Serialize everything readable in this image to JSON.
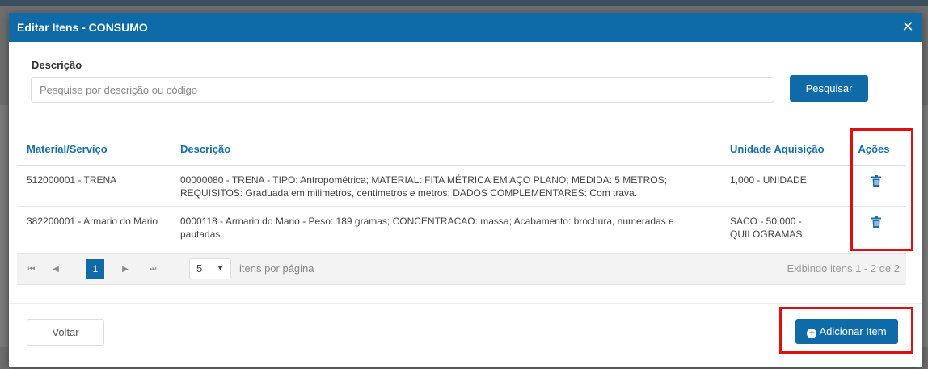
{
  "modal": {
    "title": "Editar Itens - CONSUMO",
    "close_glyph": "✕"
  },
  "search": {
    "label": "Descrição",
    "placeholder": "Pesquise por descrição ou código",
    "value": "",
    "button_label": "Pesquisar"
  },
  "table": {
    "headers": [
      "Material/Serviço",
      "Descrição",
      "Unidade Aquisição",
      "Ações"
    ],
    "rows": [
      {
        "material": "512000001 - TRENA",
        "descricao": "00000080 - TRENA - TIPO: Antropométrica; MATERIAL: FITA MÉTRICA EM AÇO PLANO; MEDIDA: 5 METROS; REQUISITOS: Graduada em milimetros, centimetros e metros; DADOS COMPLEMENTARES: Com trava.",
        "unidade": "1,000 - UNIDADE",
        "action_icon": "trash-icon"
      },
      {
        "material": "382200001 - Armario do Mario",
        "descricao": "0000118 - Armario do Mario - Peso: 189 gramas; CONCENTRACAO: massa; Acabamento: brochura, numeradas e pautadas.",
        "unidade": "SACO - 50,000 - QUILOGRAMAS",
        "action_icon": "trash-icon"
      }
    ]
  },
  "pager": {
    "first": "⏮",
    "prev": "◀",
    "next": "▶",
    "last": "⏭",
    "current_page": "1",
    "page_size": "5",
    "per_page_label": "itens por página",
    "showing_label": "Exibindo itens 1 - 2 de 2"
  },
  "footer": {
    "back_label": "Voltar",
    "add_label": "Adicionar Item"
  },
  "colors": {
    "primary": "#0f6aa8",
    "header_text": "#1a6fa9",
    "highlight": "#e01010"
  }
}
